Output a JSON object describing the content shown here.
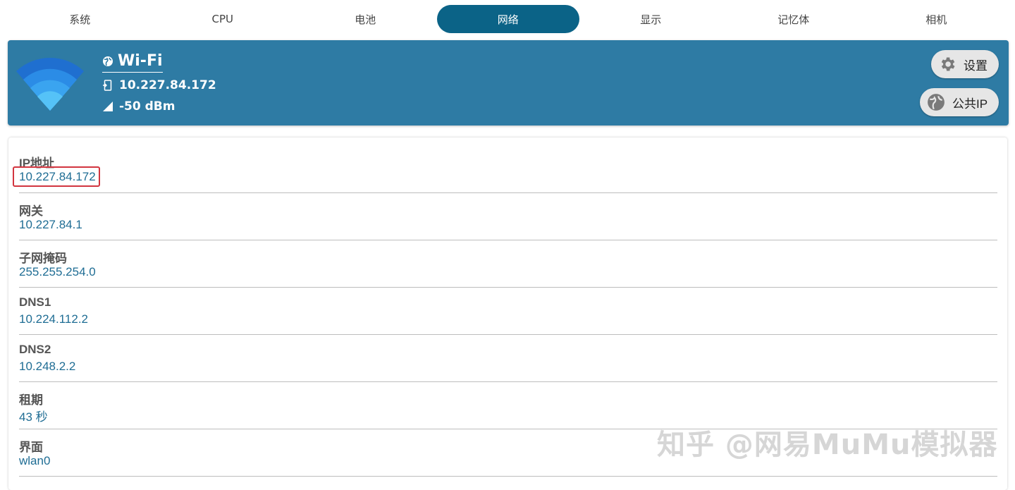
{
  "tabs": [
    {
      "label": "系统",
      "active": false
    },
    {
      "label": "CPU",
      "active": false
    },
    {
      "label": "电池",
      "active": false
    },
    {
      "label": "网络",
      "active": true
    },
    {
      "label": "显示",
      "active": false
    },
    {
      "label": "记忆体",
      "active": false
    },
    {
      "label": "相机",
      "active": false
    }
  ],
  "header": {
    "network_name": "Wi-Fi",
    "ip": "10.227.84.172",
    "signal": "-50 dBm",
    "settings_label": "设置",
    "public_ip_label": "公共IP",
    "background_color": "#2e7ba4"
  },
  "details": [
    {
      "label": "IP地址",
      "value": "10.227.84.172"
    },
    {
      "label": "网关",
      "value": "10.227.84.1"
    },
    {
      "label": "子网掩码",
      "value": "255.255.254.0"
    },
    {
      "label": "DNS1",
      "value": "10.224.112.2"
    },
    {
      "label": "DNS2",
      "value": "10.248.2.2"
    },
    {
      "label": "租期",
      "value": "43 秒"
    },
    {
      "label": "界面",
      "value": "wlan0"
    }
  ],
  "watermark": "知乎 @网易MuMu模拟器",
  "accent_color": "#0b6387",
  "value_color": "#1f6d94"
}
